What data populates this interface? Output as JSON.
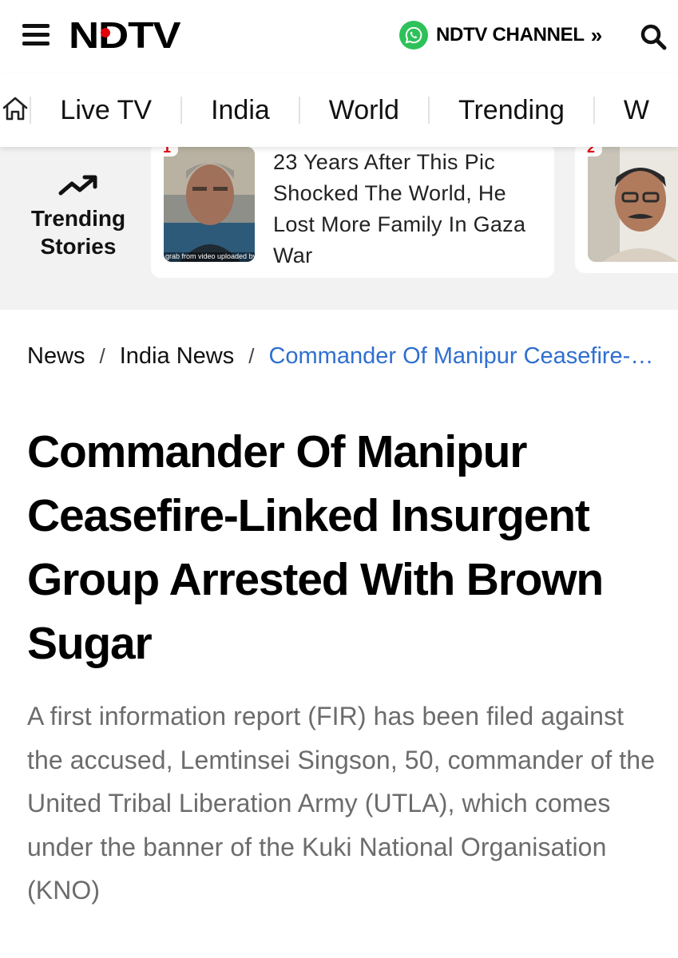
{
  "header": {
    "logo_text": "NDTV",
    "channel_label": "NDTV CHANNEL",
    "channel_chevron": "»"
  },
  "nav": {
    "items": [
      "Live TV",
      "India",
      "World",
      "Trending",
      "W"
    ]
  },
  "trending": {
    "label_line1": "Trending",
    "label_line2": "Stories",
    "cards": [
      {
        "rank": "1",
        "title": "23 Years After This Pic Shocked The World, He Lost More Family In Gaza War",
        "image_caption": "grab from video uploaded by"
      },
      {
        "rank": "2",
        "title": ""
      }
    ]
  },
  "breadcrumb": {
    "items": [
      "News",
      "India News"
    ],
    "separator": "/",
    "current": "Commander Of Manipur Ceasefire-Linked Insurgent Group Arrested With Brown Sugar"
  },
  "article": {
    "headline": "Commander Of Manipur Ceasefire-Linked Insurgent Group Arrested With Brown Sugar",
    "summary": "A first information report (FIR) has been filed against the accused, Lemtinsei Singson, 50, commander of the United Tribal Liberation Army (UTLA), which comes under the banner of the Kuki National Organisation (KNO)"
  },
  "colors": {
    "brand_red": "#e3000b",
    "whatsapp_green": "#2ec15a",
    "link_blue": "#2f6fd0",
    "summary_gray": "#6c6c6c",
    "trending_bg": "#f2f2f2"
  },
  "icons": [
    "hamburger-menu-icon",
    "whatsapp-icon",
    "double-chevron-right-icon",
    "search-icon",
    "home-icon",
    "trending-up-icon"
  ]
}
